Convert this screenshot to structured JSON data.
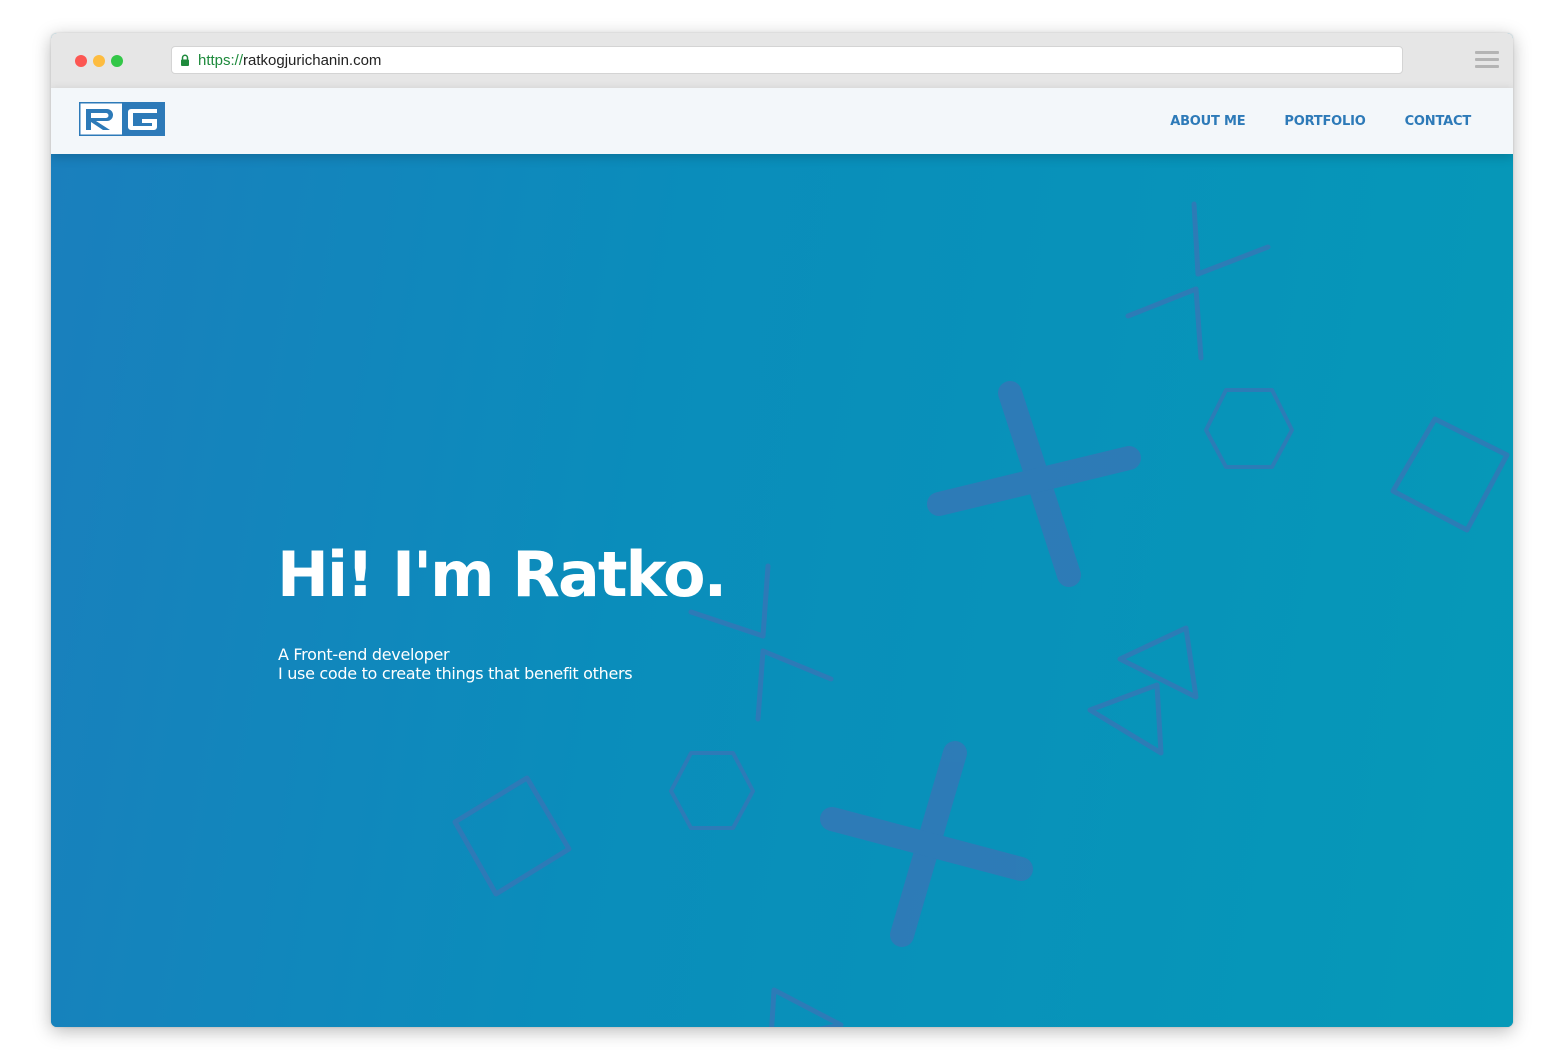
{
  "browser": {
    "url_scheme": "https://",
    "url_host": "ratkogjurichanin.com"
  },
  "site": {
    "logo_text": "RG",
    "nav": [
      {
        "label": "ABOUT ME"
      },
      {
        "label": "PORTFOLIO"
      },
      {
        "label": "CONTACT"
      }
    ]
  },
  "hero": {
    "title": "Hi! I'm Ratko.",
    "subtitle_line1": "A Front-end developer",
    "subtitle_line2": "I use code to create things that benefit others"
  },
  "colors": {
    "accent": "#2d7ab8",
    "hero_gradient_start": "#1a7fbd",
    "hero_gradient_end": "#0599b8",
    "shape_color": "#3a74b6"
  },
  "icons": [
    "lock-icon",
    "menu-icon",
    "logo-mark"
  ]
}
